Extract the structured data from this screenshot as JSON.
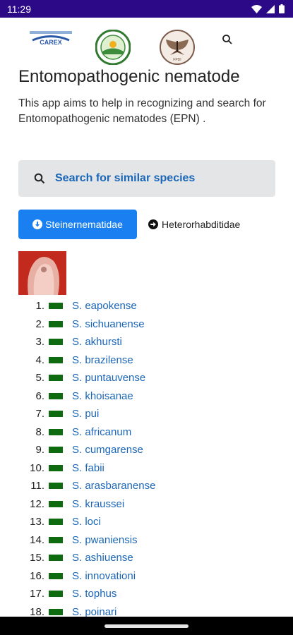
{
  "status": {
    "time": "11:29"
  },
  "header": {
    "logo1_text": "CAREX",
    "logo3_text": "FPDI"
  },
  "app": {
    "title": "Entomopathogenic nematode",
    "description": "This app aims to help in recognizing and search for Entomopathogenic nematodes (EPN) ."
  },
  "search": {
    "label": "Search for similar species"
  },
  "tabs": [
    {
      "label": "Steinernematidae",
      "active": true
    },
    {
      "label": "Heterorhabditidae",
      "active": false
    }
  ],
  "colors": {
    "status_bar": "#2c0a87",
    "accent": "#1a7ff0",
    "link": "#1a66b8",
    "swatch": "#0f6b0f"
  },
  "species": [
    {
      "num": "1.",
      "name": "S. eapokense"
    },
    {
      "num": "2.",
      "name": "S. sichuanense"
    },
    {
      "num": "3.",
      "name": "S. akhursti"
    },
    {
      "num": "4.",
      "name": "S. brazilense"
    },
    {
      "num": "5.",
      "name": "S. puntauvense"
    },
    {
      "num": "6.",
      "name": "S. khoisanae"
    },
    {
      "num": "7.",
      "name": "S. pui"
    },
    {
      "num": "8.",
      "name": "S. africanum"
    },
    {
      "num": "9.",
      "name": "S. cumgarense"
    },
    {
      "num": "10.",
      "name": "S. fabii"
    },
    {
      "num": "11.",
      "name": "S. arasbaranense"
    },
    {
      "num": "12.",
      "name": "S. kraussei"
    },
    {
      "num": "13.",
      "name": "S. loci"
    },
    {
      "num": "14.",
      "name": "S. pwaniensis"
    },
    {
      "num": "15.",
      "name": "S. ashiuense"
    },
    {
      "num": "16.",
      "name": "S. innovationi"
    },
    {
      "num": "17.",
      "name": "S. tophus"
    },
    {
      "num": "18.",
      "name": "S. poinari"
    }
  ]
}
